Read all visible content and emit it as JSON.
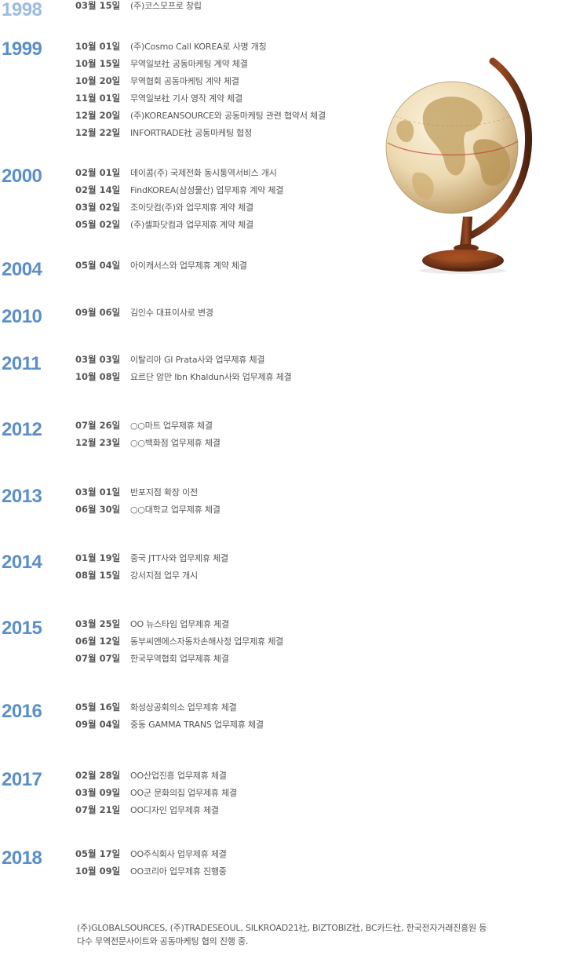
{
  "timeline": [
    {
      "year": "1998",
      "entries": [
        {
          "date": "03월 15일",
          "text": "(주)코스모프로 창립"
        }
      ]
    },
    {
      "year": "1999",
      "entries": [
        {
          "date": "10월 01일",
          "text": "(주)Cosmo Call KOREA로 사명 개칭"
        },
        {
          "date": "10월 15일",
          "text": "무역일보社 공동마케팅 계약 체결"
        },
        {
          "date": "10월 20일",
          "text": "무역협회 공동마케팅 계약 체결"
        },
        {
          "date": "11월 01일",
          "text": "무역일보社 기사 영작 계약 체결"
        },
        {
          "date": "12월 20일",
          "text": "(주)KOREANSOURCE와 공동마케팅 관련 협약서 체결"
        },
        {
          "date": "12월 22일",
          "text": "INFORTRADE社 공동마케팅 협정"
        }
      ]
    },
    {
      "year": "2000",
      "entries": [
        {
          "date": "02월 01일",
          "text": "데이콤(주) 국제전화 동시통역서비스 개시"
        },
        {
          "date": "02월 14일",
          "text": "FindKOREA(삼성물산) 업무제휴 계약 체결"
        },
        {
          "date": "03월 02일",
          "text": "조이닷컴(주)와 업무제휴 계약 체결"
        },
        {
          "date": "05월 02일",
          "text": "(주)셀파닷컴과 업무제휴 계약 체결"
        }
      ]
    },
    {
      "year": "2004",
      "entries": [
        {
          "date": "05월 04일",
          "text": "아이캐서스와 업무제휴 계약 체결"
        }
      ]
    },
    {
      "year": "2010",
      "entries": [
        {
          "date": "09월 06일",
          "text": "김인수 대표이사로 변경"
        }
      ]
    },
    {
      "year": "2011",
      "entries": [
        {
          "date": "03월 03일",
          "text": "이탈리아 GI Prata사와 업무제휴 체결"
        },
        {
          "date": "10월 08일",
          "text": "요르단 암만 Ibn Khaldun사와 업무제휴 체결"
        }
      ]
    },
    {
      "year": "2012",
      "entries": [
        {
          "date": "07월 26일",
          "text": "○○마트 업무제휴 체결"
        },
        {
          "date": "12월 23일",
          "text": "○○백화점 업무제휴 체결"
        }
      ]
    },
    {
      "year": "2013",
      "entries": [
        {
          "date": "03월 01일",
          "text": "반포지점 확장 이전"
        },
        {
          "date": "06월 30일",
          "text": "○○대학교 업무제휴 체결"
        }
      ]
    },
    {
      "year": "2014",
      "entries": [
        {
          "date": "01월 19일",
          "text": "중국 JTT사와 업무제휴 체결"
        },
        {
          "date": "08월 15일",
          "text": "강서지점 업무 개시"
        }
      ]
    },
    {
      "year": "2015",
      "entries": [
        {
          "date": "03월 25일",
          "text": "OO 뉴스타임 업무제휴 체결"
        },
        {
          "date": "06월 12일",
          "text": "동부씨앤에스자동차손해사정 업무제휴 체결"
        },
        {
          "date": "07월 07일",
          "text": "한국무역협회 업무제휴 체결"
        }
      ]
    },
    {
      "year": "2016",
      "entries": [
        {
          "date": "05월 16일",
          "text": "화성상공회의소 업무제휴 체결"
        },
        {
          "date": "09월 04일",
          "text": "중동 GAMMA TRANS 업무제휴 체결"
        }
      ]
    },
    {
      "year": "2017",
      "entries": [
        {
          "date": "02월 28일",
          "text": "OO산업진흥 업무제휴 체결"
        },
        {
          "date": "03월 09일",
          "text": "OO군 문화의집 업무제휴 체결"
        },
        {
          "date": "07월 21일",
          "text": "OO디자인 업무제휴 체결"
        }
      ]
    },
    {
      "year": "2018",
      "entries": [
        {
          "date": "05월 17일",
          "text": "OO주식회사 업무제휴 체결"
        },
        {
          "date": "10월 09일",
          "text": "OO코리아 업무제휴 진행중"
        }
      ]
    }
  ],
  "footer": {
    "line1": "(주)GLOBALSOURCES, (주)TRADESEOUL, SILKROAD21社, BIZTOBIZ社, BC카드社, 한국전자거래진흥원 등",
    "line2": "다수 무역전문사이트와 공동마케팅 협의 진행 중."
  },
  "colors": {
    "year": "#5b8fc8",
    "year_first": "#9bbbe0",
    "text": "#555555"
  }
}
